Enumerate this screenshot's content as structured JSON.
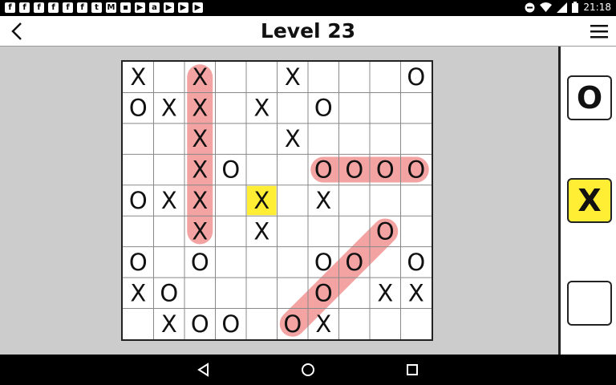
{
  "status_bar": {
    "time": "21:18",
    "notification_icons": [
      "facebook-icon",
      "facebook-icon",
      "facebook-icon",
      "facebook-icon",
      "facebook-icon",
      "facebook-icon",
      "twitter-icon",
      "gmail-icon",
      "chat-icon",
      "play-icon",
      "android-icon",
      "youtube-icon",
      "youtube-icon",
      "youtube-icon"
    ]
  },
  "header": {
    "title": "Level 23"
  },
  "board": {
    "rows": 9,
    "cols": 10,
    "cells": [
      [
        "X",
        "",
        "X",
        "",
        "",
        "X",
        "",
        "",
        "",
        "O"
      ],
      [
        "O",
        "X",
        "X",
        "",
        "X",
        "",
        "O",
        "",
        "",
        ""
      ],
      [
        "",
        "",
        "X",
        "",
        "",
        "X",
        "",
        "",
        "",
        ""
      ],
      [
        "",
        "",
        "X",
        "O",
        "",
        "",
        "O",
        "O",
        "O",
        "O"
      ],
      [
        "O",
        "X",
        "X",
        "",
        "X",
        "",
        "X",
        "",
        "",
        ""
      ],
      [
        "",
        "",
        "X",
        "",
        "X",
        "",
        "",
        "",
        "O",
        ""
      ],
      [
        "O",
        "",
        "O",
        "",
        "",
        "",
        "O",
        "O",
        "",
        "O"
      ],
      [
        "X",
        "O",
        "",
        "",
        "",
        "",
        "O",
        "",
        "X",
        "X"
      ],
      [
        "",
        "X",
        "O",
        "O",
        "",
        "O",
        "X",
        "",
        "",
        ""
      ]
    ],
    "selected_cell": {
      "row": 4,
      "col": 4
    },
    "highlight_color": "#f4a3a3",
    "selected_color": "#ffee33",
    "highlights": [
      {
        "from": [
          0,
          2
        ],
        "to": [
          5,
          2
        ]
      },
      {
        "from": [
          3,
          6
        ],
        "to": [
          3,
          9
        ]
      },
      {
        "from": [
          5,
          8
        ],
        "to": [
          8,
          5
        ]
      }
    ]
  },
  "palette": {
    "items": [
      {
        "label": "O",
        "selected": false
      },
      {
        "label": "X",
        "selected": true
      },
      {
        "label": "",
        "selected": false
      }
    ],
    "selected_color": "#ffee33"
  },
  "nav": {
    "back": "back-triangle-icon",
    "home": "home-circle-icon",
    "recents": "recents-square-icon"
  }
}
